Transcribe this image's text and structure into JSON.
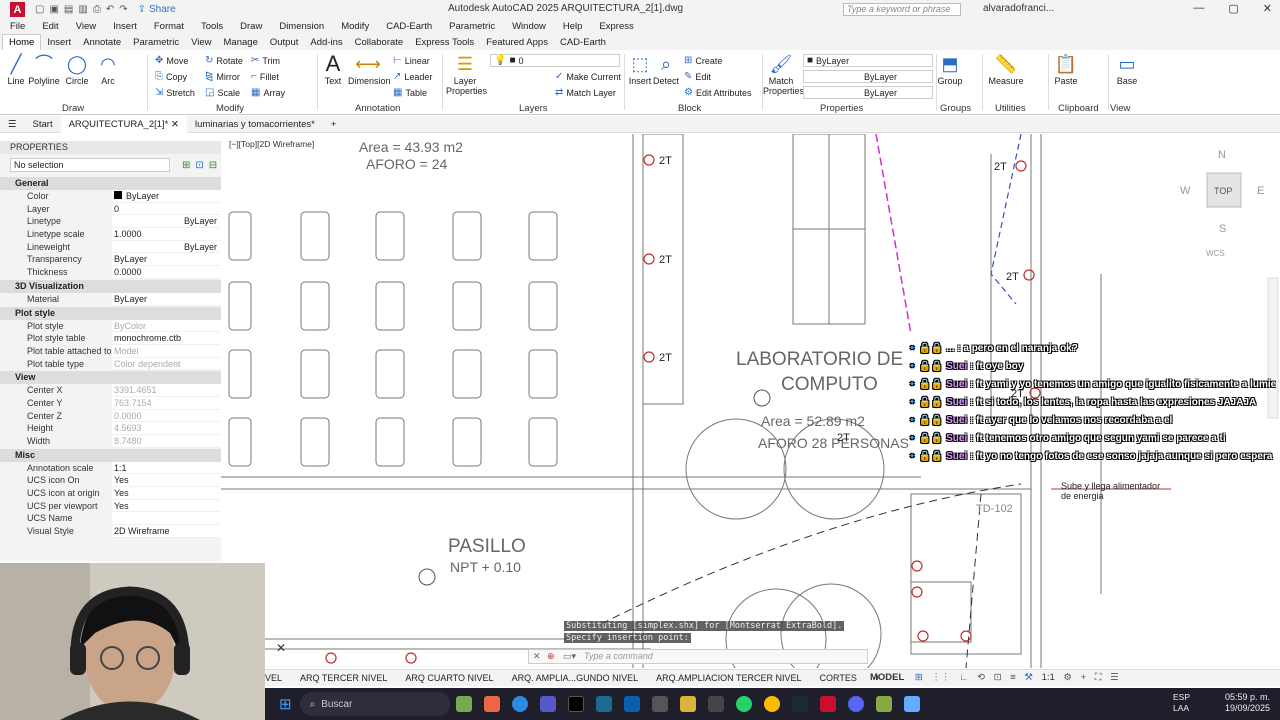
{
  "app": {
    "share": "Share",
    "title": "Autodesk AutoCAD 2025    ARQUITECTURA_2[1].dwg",
    "search_placeholder": "Type a keyword or phrase",
    "user": "alvaradofranci..."
  },
  "menu": [
    "File",
    "Edit",
    "View",
    "Insert",
    "Format",
    "Tools",
    "Draw",
    "Dimension",
    "Modify",
    "CAD-Earth",
    "Parametric",
    "Window",
    "Help",
    "Express"
  ],
  "ribbon_tabs": [
    "Home",
    "Insert",
    "Annotate",
    "Parametric",
    "View",
    "Manage",
    "Output",
    "Add-ins",
    "Collaborate",
    "Express Tools",
    "Featured Apps",
    "CAD-Earth"
  ],
  "ribbon": {
    "draw": {
      "line": "Line",
      "polyline": "Polyline",
      "circle": "Circle",
      "arc": "Arc",
      "label": "Draw"
    },
    "modify": {
      "move": "Move",
      "rotate": "Rotate",
      "trim": "Trim",
      "copy": "Copy",
      "mirror": "Mirror",
      "fillet": "Fillet",
      "stretch": "Stretch",
      "scale": "Scale",
      "array": "Array",
      "label": "Modify"
    },
    "annotation": {
      "text": "Text",
      "dimension": "Dimension",
      "linear": "Linear",
      "leader": "Leader",
      "table": "Table",
      "label": "Annotation"
    },
    "layers": {
      "props": "Layer Properties",
      "current": "0",
      "make_current": "Make Current",
      "match_layer": "Match Layer",
      "label": "Layers"
    },
    "block": {
      "insert": "Insert",
      "detect": "Detect",
      "create": "Create",
      "edit": "Edit",
      "edit_attr": "Edit Attributes",
      "label": "Block"
    },
    "properties": {
      "match": "Match Properties",
      "bylayer1": "ByLayer",
      "bylayer2": "ByLayer",
      "bylayer3": "ByLayer",
      "label": "Properties"
    },
    "groups": {
      "group": "Group",
      "label": "Groups"
    },
    "utilities": {
      "measure": "Measure",
      "label": "Utilities"
    },
    "clipboard": {
      "paste": "Paste",
      "label": "Clipboard"
    },
    "view": {
      "base": "Base",
      "label": "View"
    }
  },
  "doc_tabs": {
    "start": "Start",
    "active": "ARQUITECTURA_2[1]*",
    "other": "luminarias y tomacorrientes*"
  },
  "viewport_label": "[−][Top][2D Wireframe]",
  "properties": {
    "title": "PROPERTIES",
    "selection": "No selection",
    "sections": [
      {
        "name": "General",
        "rows": [
          [
            "Color",
            "ByLayer"
          ],
          [
            "Layer",
            "0"
          ],
          [
            "Linetype",
            "ByLayer"
          ],
          [
            "Linetype scale",
            "1.0000"
          ],
          [
            "Lineweight",
            "ByLayer"
          ],
          [
            "Transparency",
            "ByLayer"
          ],
          [
            "Thickness",
            "0.0000"
          ]
        ]
      },
      {
        "name": "3D Visualization",
        "rows": [
          [
            "Material",
            "ByLayer"
          ]
        ]
      },
      {
        "name": "Plot style",
        "rows": [
          [
            "Plot style",
            "ByColor"
          ],
          [
            "Plot style table",
            "monochrome.ctb"
          ],
          [
            "Plot table attached to",
            "Model"
          ],
          [
            "Plot table type",
            "Color dependent"
          ]
        ]
      },
      {
        "name": "View",
        "rows": [
          [
            "Center X",
            "3391.4651"
          ],
          [
            "Center Y",
            "763.7154"
          ],
          [
            "Center Z",
            "0.0000"
          ],
          [
            "Height",
            "4.5693"
          ],
          [
            "Width",
            "8.7480"
          ]
        ]
      },
      {
        "name": "Misc",
        "rows": [
          [
            "Annotation scale",
            "1:1"
          ],
          [
            "UCS icon On",
            "Yes"
          ],
          [
            "UCS icon at origin",
            "Yes"
          ],
          [
            "UCS per viewport",
            "Yes"
          ],
          [
            "UCS Name",
            ""
          ],
          [
            "Visual Style",
            "2D Wireframe"
          ]
        ]
      }
    ]
  },
  "drawing": {
    "area1": "Area = 43.93 m2",
    "aforo1": "AFORO = 24",
    "lab1": "LABORATORIO DE",
    "lab2": "COMPUTO",
    "area2": "Area = 52.89 m2",
    "aforo2": "AFORO  28 PERSONAS",
    "pasillo": "PASILLO",
    "npt": "NPT + 0.10",
    "tag": "2T",
    "td": "TD-102",
    "note1": "Sube y llega alimentador",
    "note2": "de energia"
  },
  "chat": [
    {
      "name": "",
      "text": "... : a pero en el naranja ok?"
    },
    {
      "name": "Suei",
      "text": " : ft oye boy"
    },
    {
      "name": "Suei",
      "text": " : ft yami y yo tenemos un amigo que igualito fisicamente a lumiere xd"
    },
    {
      "name": "Suei",
      "text": " : ft si todo, los lentes, la ropa hasta las expresiones JAJAJA"
    },
    {
      "name": "Suei",
      "text": " : ft ayer que lo velamos nos recordaba a el"
    },
    {
      "name": "Suei",
      "text": " : ft tenemos otro amigo que segun yami se parece a ti"
    },
    {
      "name": "Suei",
      "text": " : ft yo no tengo fotos de ese sonso jajaja aunque si pero espera"
    }
  ],
  "command": {
    "line1": "Substituting [simplex.shx] for [Montserrat ExtraBold].",
    "line2": "Specify insertion point:",
    "placeholder": "Type a command"
  },
  "viewcube": {
    "n": "N",
    "s": "S",
    "e": "E",
    "w": "W",
    "top": "TOP",
    "wcs": "WCS"
  },
  "layout_tabs": [
    "VEL",
    "ARQ TERCER NIVEL",
    "ARQ CUARTO NIVEL",
    "ARQ. AMPLIA...GUNDO NIVEL",
    "ARQ.AMPLIACION TERCER NIVEL",
    "CORTES"
  ],
  "status": {
    "model": "MODEL",
    "scale": "1:1"
  },
  "taskbar": {
    "search": "Buscar",
    "lang1": "ESP",
    "lang2": "LAA",
    "time": "05:59 p. m.",
    "date": "19/09/2025"
  }
}
